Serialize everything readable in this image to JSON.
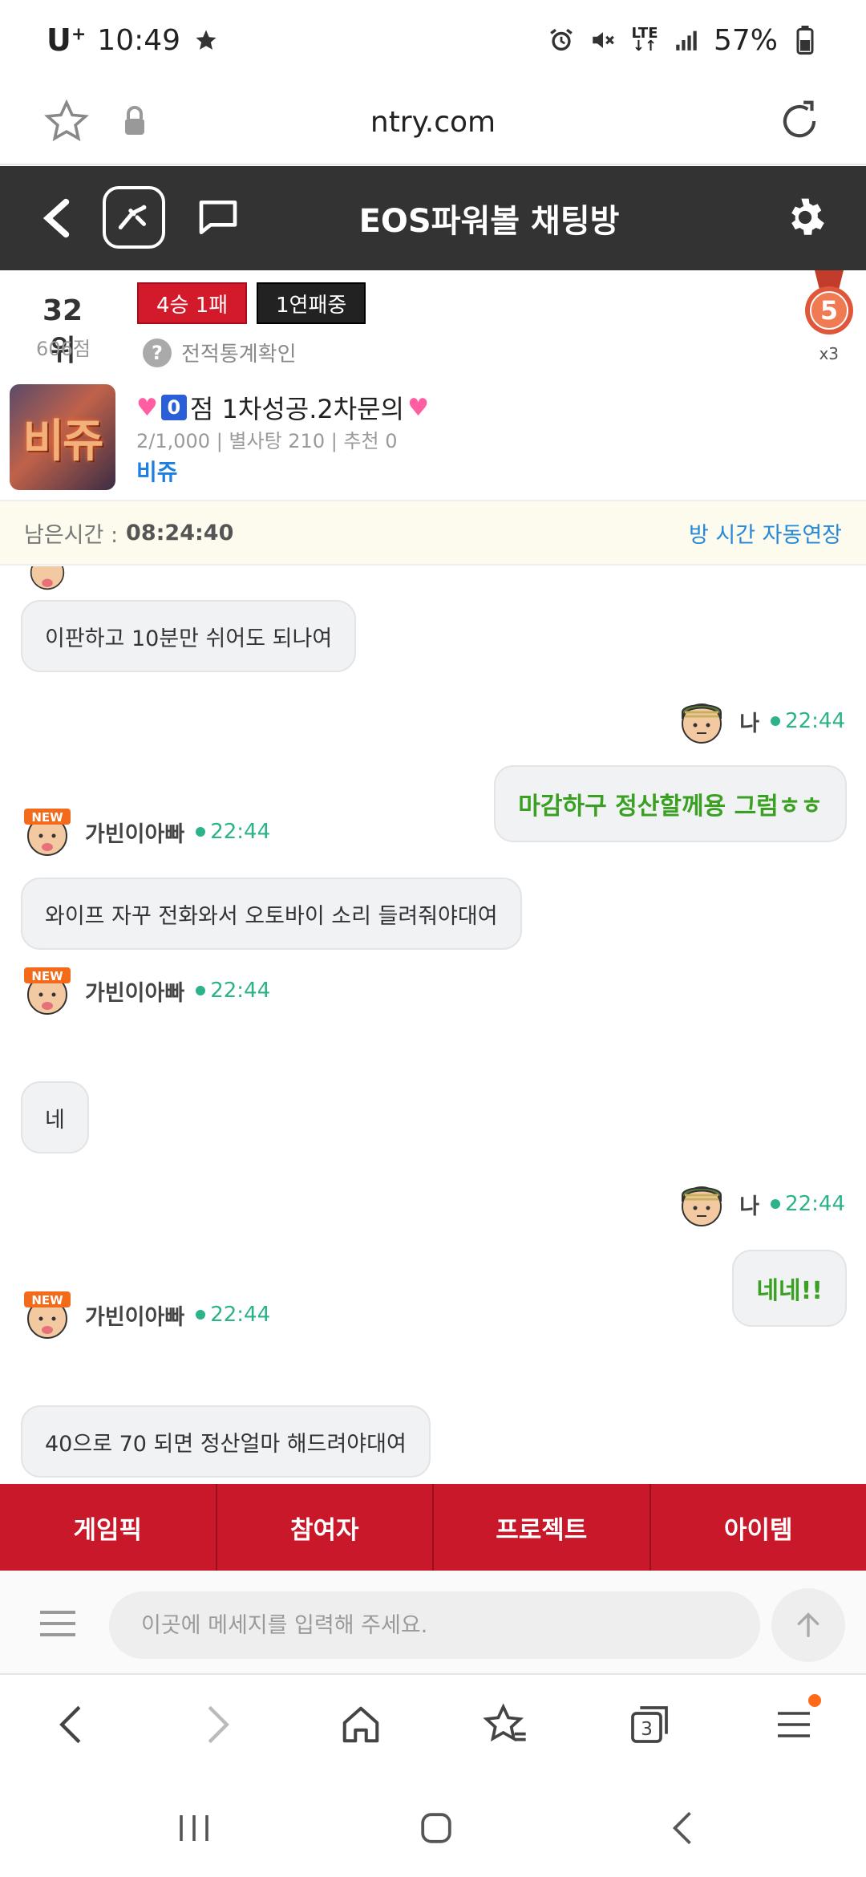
{
  "status_bar": {
    "carrier": "U",
    "carrier_sup": "+",
    "time": "10:49",
    "battery": "57%",
    "network": "LTE"
  },
  "browser": {
    "url": "ntry.com"
  },
  "header": {
    "title": "EOS파워볼 채팅방"
  },
  "profile": {
    "rank": "32위",
    "points": "606점",
    "record_badge": "4승 1패",
    "streak_badge": "1연패중",
    "stats_link": "전적통계확인",
    "medal_number": "5",
    "medal_count": "x3",
    "avatar_text": "비쥬",
    "room_title_prefix": "점 1차성공.2차문의",
    "room_title_num": "0",
    "room_meta": "2/1,000 | 별사탕 210 | 추천 0",
    "owner": "비쥬"
  },
  "timer": {
    "label": "남은시간 :",
    "value": "08:24:40",
    "extend": "방 시간 자동연장"
  },
  "messages": [
    {
      "side": "left",
      "text": "이판하고 10분만 쉬어도 되나여"
    },
    {
      "side": "right",
      "nick": "나",
      "time": "22:44",
      "text": "마감하구 정산할께용 그럼ㅎㅎ"
    },
    {
      "side": "left",
      "nick": "가빈이아빠",
      "time": "22:44",
      "text": "와이프 자꾸 전화와서 오토바이 소리 들려줘야대여"
    },
    {
      "side": "left",
      "nick": "가빈이아빠",
      "time": "22:44",
      "text": "네"
    },
    {
      "side": "right",
      "nick": "나",
      "time": "22:44",
      "text": "네네!!"
    },
    {
      "side": "left",
      "nick": "가빈이아빠",
      "time": "22:44",
      "text": "40으로 70 되면 정산얼마 해드려야대여"
    }
  ],
  "avatar_badge": "NEW",
  "tabs": [
    "게임픽",
    "참여자",
    "프로젝트",
    "아이템"
  ],
  "input": {
    "placeholder": "이곳에 메세지를 입력해 주세요."
  },
  "browser_bar": {
    "tab_count": "3"
  },
  "colors": {
    "header_bg": "#333333",
    "tab_red": "#c8182a",
    "time_green": "#2db28a",
    "my_text_green": "#3aa022",
    "link_blue": "#1f7fe0"
  }
}
